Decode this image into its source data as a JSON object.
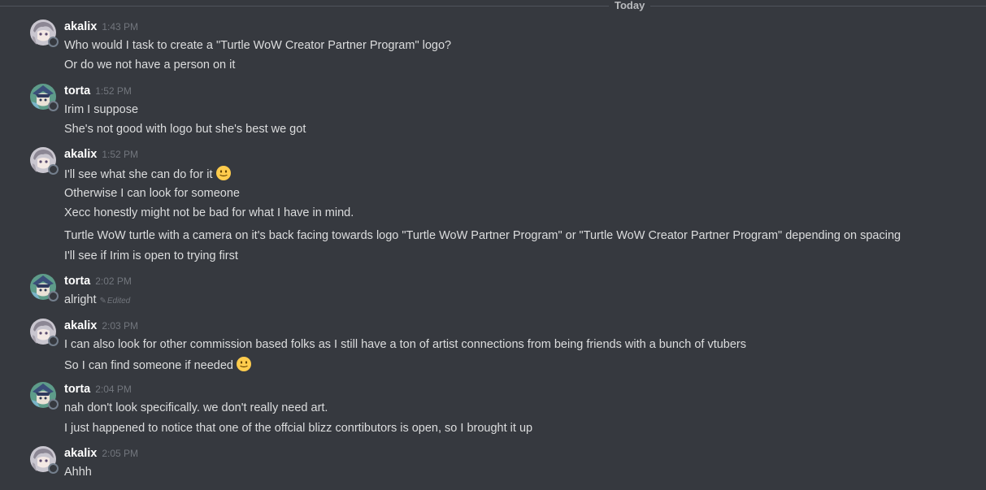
{
  "divider": {
    "label": "Today"
  },
  "groups": [
    {
      "username": "akalix",
      "timestamp": "1:43 PM",
      "avatar": "akalix-avatar",
      "messages": [
        "Who would I task to create a \"Turtle WoW Creator Partner Program\" logo?",
        "Or do we not have a person on it"
      ]
    },
    {
      "username": "torta",
      "timestamp": "1:52 PM",
      "avatar": "torta-avatar",
      "messages": [
        "Irim I suppose",
        "She's not good with logo but she's best we got"
      ]
    },
    {
      "username": "akalix",
      "timestamp": "1:52 PM",
      "avatar": "akalix-avatar",
      "messages": [
        "I'll see what she can do for it",
        "Otherwise I can look for someone",
        "Xecc honestly might not be bad for what I have in mind.",
        "Turtle WoW turtle with a camera on it's back facing towards logo \"Turtle WoW Partner Program\" or \"Turtle WoW Creator Partner Program\" depending on spacing",
        "I'll see if Irim is open to trying first"
      ]
    },
    {
      "username": "torta",
      "timestamp": "2:02 PM",
      "avatar": "torta-avatar",
      "messages": [
        "alright"
      ],
      "edited_label": "Edited"
    },
    {
      "username": "akalix",
      "timestamp": "2:03 PM",
      "avatar": "akalix-avatar",
      "messages": [
        "I can also look for other commission based folks as I still have a ton of artist connections from being friends with a bunch of vtubers",
        "So I can find someone if needed"
      ]
    },
    {
      "username": "torta",
      "timestamp": "2:04 PM",
      "avatar": "torta-avatar",
      "messages": [
        "nah don't look specifically. we don't really need art.",
        "I just happened to notice that one of the offcial blizz conrtibutors is open, so I brought it up"
      ]
    },
    {
      "username": "akalix",
      "timestamp": "2:05 PM",
      "avatar": "akalix-avatar",
      "messages": [
        "Ahhh"
      ]
    }
  ],
  "colors": {
    "background": "#36393f",
    "username": "#ffffff",
    "timestamp": "#72767d",
    "text": "#dcddde",
    "status_offline": "#747f8d"
  }
}
